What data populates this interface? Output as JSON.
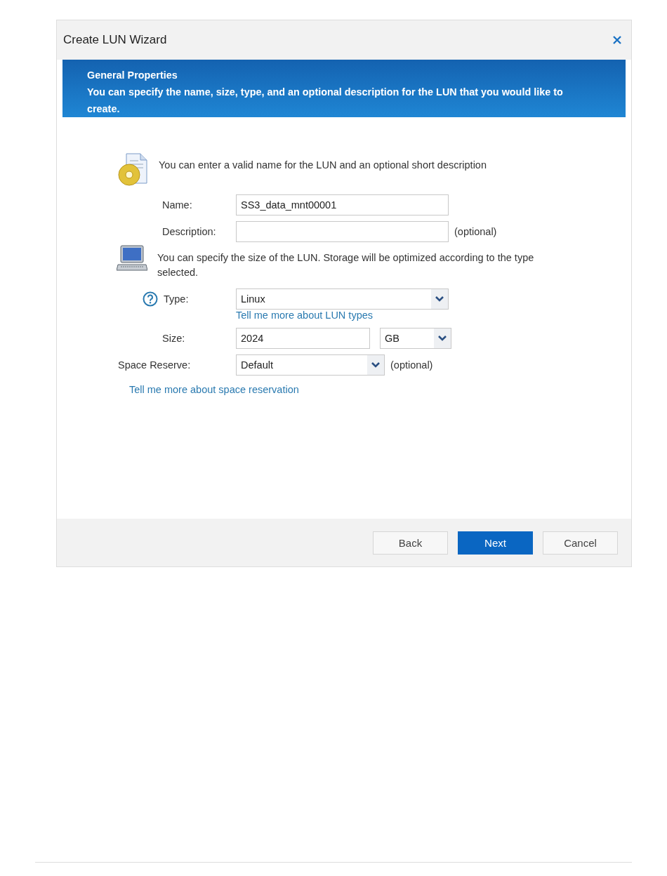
{
  "window": {
    "title": "Create LUN Wizard"
  },
  "banner": {
    "title": "General Properties",
    "text": "You can specify the name, size, type, and an optional description for the LUN that you would like to create."
  },
  "sections": [
    {
      "text": "You can enter a valid name for the LUN and an optional short description",
      "fields": [
        {
          "kind": "text",
          "help": false,
          "label": "Name:",
          "value": "SS3_data_mnt00001"
        },
        {
          "kind": "text",
          "help": false,
          "label": "Description:",
          "note": "(optional)"
        }
      ]
    },
    {
      "text": "You can specify the size of the LUN. Storage will be optimized according to the type selected.",
      "fields": [
        {
          "kind": "select",
          "help": true,
          "label": "Type:",
          "value": "Linux",
          "link": "Tell me more about LUN types"
        },
        {
          "kind": "size",
          "help": false,
          "label": "Size:",
          "value": "2024",
          "unit": "GB"
        }
      ]
    }
  ],
  "space_reserve": {
    "label": "Space Reserve:",
    "value": "Default",
    "note": "(optional)",
    "link": "Tell me more about space reservation"
  },
  "buttons": [
    {
      "label": "Back",
      "primary": false
    },
    {
      "label": "Next",
      "primary": true
    },
    {
      "label": "Cancel",
      "primary": false
    }
  ]
}
